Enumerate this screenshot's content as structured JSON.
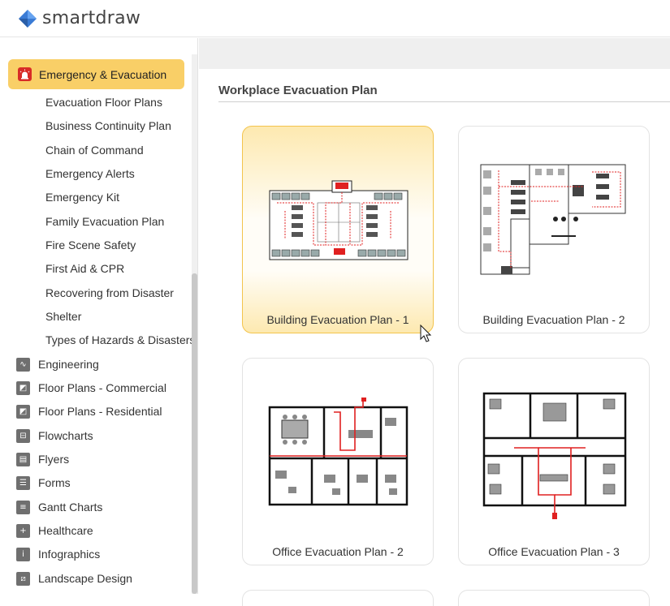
{
  "app": {
    "logo_text": "smartdraw"
  },
  "sidebar": {
    "active_category": "Emergency & Evacuation",
    "subitems": [
      "Evacuation Floor Plans",
      "Business Continuity Plan",
      "Chain of Command",
      "Emergency Alerts",
      "Emergency Kit",
      "Family Evacuation Plan",
      "Fire Scene Safety",
      "First Aid & CPR",
      "Recovering from Disaster",
      "Shelter",
      "Types of Hazards & Disasters"
    ],
    "categories": [
      {
        "label": "Engineering",
        "icon": "waveform-icon"
      },
      {
        "label": "Floor Plans - Commercial",
        "icon": "floorplan-icon"
      },
      {
        "label": "Floor Plans - Residential",
        "icon": "floorplan-icon"
      },
      {
        "label": "Flowcharts",
        "icon": "flowchart-icon"
      },
      {
        "label": "Flyers",
        "icon": "document-icon"
      },
      {
        "label": "Forms",
        "icon": "form-icon"
      },
      {
        "label": "Gantt Charts",
        "icon": "gantt-icon"
      },
      {
        "label": "Healthcare",
        "icon": "plus-icon"
      },
      {
        "label": "Infographics",
        "icon": "info-icon"
      },
      {
        "label": "Landscape Design",
        "icon": "landscape-icon"
      }
    ]
  },
  "main": {
    "section_title": "Workplace Evacuation Plan",
    "templates": [
      {
        "label": "Building Evacuation Plan - 1",
        "selected": true
      },
      {
        "label": "Building Evacuation Plan - 2",
        "selected": false
      },
      {
        "label": "Office Evacuation Plan - 2",
        "selected": false
      },
      {
        "label": "Office Evacuation Plan - 3",
        "selected": false
      }
    ]
  },
  "colors": {
    "accent": "#f9cf67",
    "emergency_icon": "#d82b27",
    "route_red": "#e02020"
  }
}
